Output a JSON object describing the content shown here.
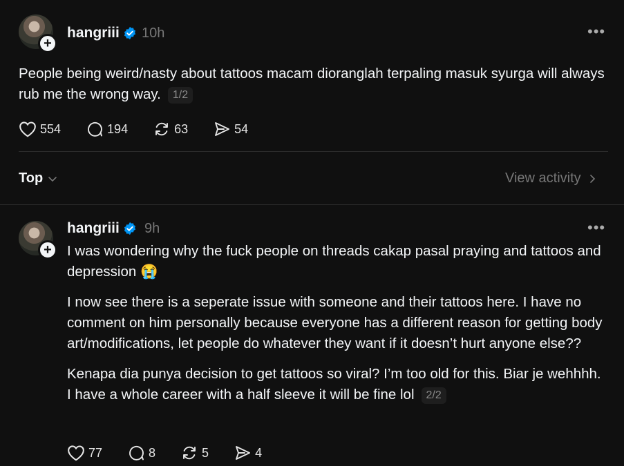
{
  "post": {
    "username": "hangriii",
    "time": "10h",
    "text": "People being weird/nasty about tattoos macam dioranglah terpaling masuk syurga will always rub me the wrong way.",
    "pager": "1/2",
    "likes": "554",
    "replies": "194",
    "reposts": "63",
    "shares": "54"
  },
  "sort_bar": {
    "sort_label": "Top",
    "view_activity": "View activity"
  },
  "reply": {
    "username": "hangriii",
    "time": "9h",
    "p1": "I was wondering why the fuck people on threads cakap pasal praying and tattoos and depression 😭",
    "p2": "I now see there is a seperate issue with someone and their tattoos here. I have no comment on him personally because everyone has a different reason for getting body art/modifications, let people do whatever they want if it doesn’t hurt anyone else??",
    "p3": "Kenapa dia punya decision to get tattoos so viral? I’m too old for this. Biar je wehhhh. I have a whole career with a half sleeve it will be fine lol",
    "pager": "2/2",
    "likes": "77",
    "replies": "8",
    "reposts": "5",
    "shares": "4"
  },
  "colors": {
    "background": "#101010",
    "verified": "#0095f6",
    "muted": "#777777"
  },
  "icons": [
    "more-icon",
    "heart-icon",
    "comment-icon",
    "repost-icon",
    "share-icon",
    "chevron-down-icon",
    "chevron-right-icon",
    "verified-badge-icon",
    "plus-icon"
  ]
}
